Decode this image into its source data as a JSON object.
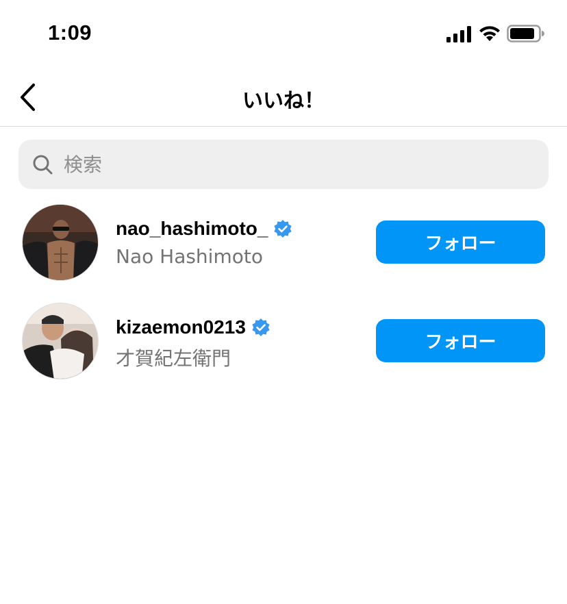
{
  "status_bar": {
    "time": "1:09",
    "icons": [
      "signal-icon",
      "wifi-icon",
      "battery-icon"
    ]
  },
  "header": {
    "title": "いいね！",
    "back_icon": "chevron-left-icon"
  },
  "search": {
    "placeholder": "検索",
    "value": ""
  },
  "users": [
    {
      "username": "nao_hashimoto_",
      "full_name": "Nao Hashimoto",
      "verified": true,
      "follow_label": "フォロー"
    },
    {
      "username": "kizaemon0213",
      "full_name": "才賀紀左衛門",
      "verified": true,
      "follow_label": "フォロー"
    }
  ],
  "colors": {
    "accent": "#0095f6",
    "verified": "#3897f0",
    "secondary_text": "#737373",
    "search_bg": "#efefef"
  }
}
